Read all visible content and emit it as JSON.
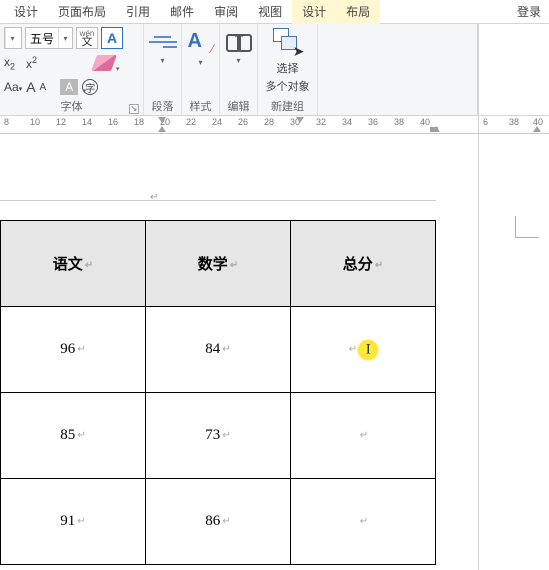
{
  "tabs": {
    "design_top": "设计",
    "page_layout": "页面布局",
    "references": "引用",
    "mailings": "邮件",
    "review": "审阅",
    "view": "视图",
    "design": "设计",
    "layout": "布局"
  },
  "login": "登录",
  "font_group": {
    "size_value": "五号",
    "pinyin_top": "wén",
    "pinyin_bot": "文",
    "char_border": "A",
    "sub_label": "x",
    "sub_sub": "2",
    "sup_label": "x",
    "sup_sup": "2",
    "aa": "Aa",
    "a_big": "A",
    "a_small": "A",
    "highlight_a": "A",
    "circle": "字",
    "group_label": "字体"
  },
  "para_group": {
    "label": "段落"
  },
  "style_group": {
    "label": "样式"
  },
  "edit_group": {
    "label": "编辑"
  },
  "select_group": {
    "line1": "选择",
    "line2": "多个对象",
    "bottom": "新建组"
  },
  "ruler_left": [
    "8",
    "10",
    "12",
    "14",
    "16",
    "18",
    "20",
    "22",
    "24",
    "26",
    "28",
    "30",
    "32",
    "34",
    "36",
    "38",
    "40"
  ],
  "ruler_right": [
    "6",
    "38",
    "40"
  ],
  "chart_data": {
    "type": "table",
    "headers": [
      "语文",
      "数学",
      "总分"
    ],
    "rows": [
      {
        "语文": 96,
        "数学": 84,
        "总分": ""
      },
      {
        "语文": 85,
        "数学": 73,
        "总分": ""
      },
      {
        "语文": 91,
        "数学": 86,
        "总分": ""
      }
    ]
  }
}
